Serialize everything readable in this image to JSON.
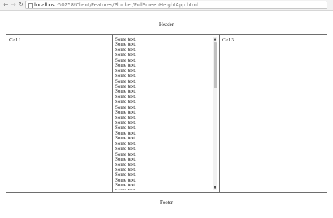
{
  "browser": {
    "back_icon": "arrow-left-icon",
    "forward_icon": "arrow-right-icon",
    "reload_icon": "reload-icon",
    "url_host": "localhost",
    "url_path": ":50258/Client/Features/Plunker/FullScreenHeightApp.html"
  },
  "page": {
    "header": "Header",
    "cell1": "Cell 1",
    "cell3": "Cell 3",
    "footer": "Footer",
    "scroll_items": [
      "Some text.",
      "Some text.",
      "Some text.",
      "Some text.",
      "Some text.",
      "Some text.",
      "Some text.",
      "Some text.",
      "Some text.",
      "Some text.",
      "Some text.",
      "Some text.",
      "Some text.",
      "Some text.",
      "Some text.",
      "Some text.",
      "Some text.",
      "Some text.",
      "Some text.",
      "Some text.",
      "Some text.",
      "Some text.",
      "Some text.",
      "Some text.",
      "Some text.",
      "Some text.",
      "Some text.",
      "Some text.",
      "Some text.",
      "Some text."
    ],
    "scroll_position": 0
  }
}
